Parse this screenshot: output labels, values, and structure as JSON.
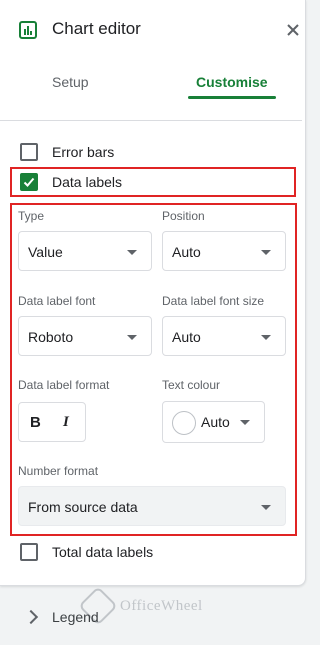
{
  "header": {
    "title": "Chart editor"
  },
  "tabs": {
    "setup": "Setup",
    "customise": "Customise"
  },
  "checkboxes": {
    "error_bars": {
      "label": "Error bars",
      "checked": false
    },
    "data_labels": {
      "label": "Data labels",
      "checked": true
    },
    "total_data_labels": {
      "label": "Total data labels",
      "checked": false
    }
  },
  "fields": {
    "type": {
      "label": "Type",
      "value": "Value"
    },
    "position": {
      "label": "Position",
      "value": "Auto"
    },
    "font": {
      "label": "Data label font",
      "value": "Roboto"
    },
    "font_size": {
      "label": "Data label font size",
      "value": "Auto"
    },
    "format": {
      "label": "Data label format",
      "bold": "B",
      "italic": "I"
    },
    "text_colour": {
      "label": "Text colour",
      "value": "Auto"
    },
    "number_format": {
      "label": "Number format",
      "value": "From source data"
    }
  },
  "legend": {
    "label": "Legend"
  },
  "watermark": {
    "text": "OfficeWheel"
  },
  "colors": {
    "accent": "#188038",
    "highlight": "#e02424"
  }
}
